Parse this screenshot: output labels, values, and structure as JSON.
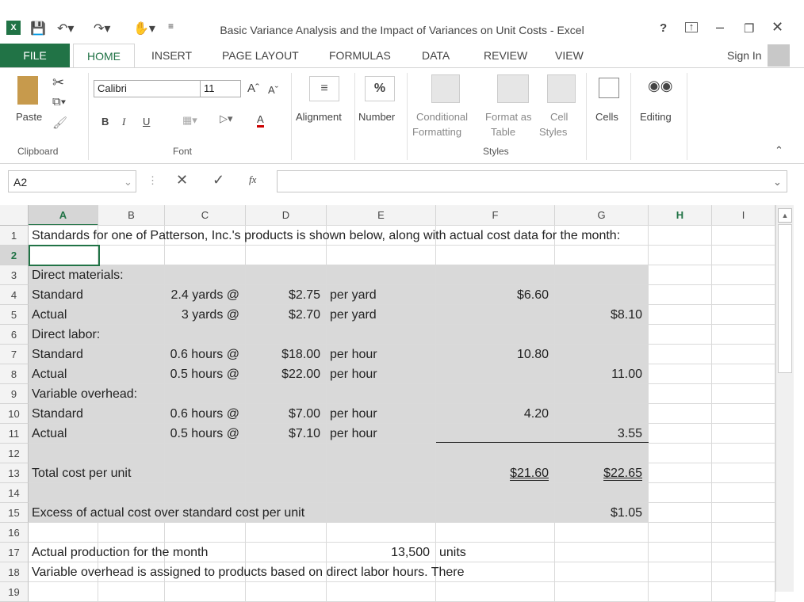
{
  "window": {
    "title": "Basic Variance Analysis and the Impact of Variances on Unit Costs - Excel",
    "help": "?",
    "sign_in": "Sign In"
  },
  "menu_tabs": [
    "FILE",
    "HOME",
    "INSERT",
    "PAGE LAYOUT",
    "FORMULAS",
    "DATA",
    "REVIEW",
    "VIEW"
  ],
  "ribbon": {
    "paste": "Paste",
    "clipboard": "Clipboard",
    "font_name": "Calibri",
    "font_size": "11",
    "font_group": "Font",
    "bold": "B",
    "italic": "I",
    "underline": "U",
    "alignment": "Alignment",
    "number": "Number",
    "percent": "%",
    "cond_fmt_1": "Conditional",
    "cond_fmt_2": "Formatting",
    "fmt_table_1": "Format as",
    "fmt_table_2": "Table",
    "cell_styles_1": "Cell",
    "cell_styles_2": "Styles",
    "styles_group": "Styles",
    "cells": "Cells",
    "editing": "Editing"
  },
  "formula_bar": {
    "name_box": "A2",
    "fx": "fx",
    "value": ""
  },
  "columns": [
    "A",
    "B",
    "C",
    "D",
    "E",
    "F",
    "G",
    "H",
    "I"
  ],
  "rows": [
    "1",
    "2",
    "3",
    "4",
    "5",
    "6",
    "7",
    "8",
    "9",
    "10",
    "11",
    "12",
    "13",
    "14",
    "15",
    "16",
    "17",
    "18",
    "19"
  ],
  "cells": {
    "r1": "Standards for one of Patterson, Inc.'s products is shown below, along with actual cost data for the month:",
    "r3": "Direct materials:",
    "r4": {
      "a": "Standard",
      "b": "2.4 yards @",
      "d": "$2.75",
      "e": "per yard",
      "f": "$6.60"
    },
    "r5": {
      "a": "Actual",
      "b": "3 yards @",
      "d": "$2.70",
      "e": "per yard",
      "g": "$8.10"
    },
    "r6": "Direct labor:",
    "r7": {
      "a": "Standard",
      "b": "0.6 hours @",
      "d": "$18.00",
      "e": "per hour",
      "f": "10.80"
    },
    "r8": {
      "a": "Actual",
      "b": "0.5 hours @",
      "d": "$22.00",
      "e": "per hour",
      "g": "11.00"
    },
    "r9": "Variable overhead:",
    "r10": {
      "a": "Standard",
      "b": "0.6 hours @",
      "d": "$7.00",
      "e": "per hour",
      "f": "4.20"
    },
    "r11": {
      "a": "Actual",
      "b": "0.5 hours @",
      "d": "$7.10",
      "e": "per hour",
      "g": "3.55"
    },
    "r13": {
      "a": "Total cost per unit",
      "f": "$21.60",
      "g": "$22.65"
    },
    "r15": {
      "a": "Excess of actual cost over standard cost per unit",
      "g": "$1.05"
    },
    "r17": {
      "a": "Actual production for the month",
      "e": "13,500",
      "f": "units"
    },
    "r18": "Variable overhead is assigned to products based on direct labor hours. There"
  },
  "colors": {
    "excel_green": "#217346",
    "shade": "#d9d9d9"
  }
}
